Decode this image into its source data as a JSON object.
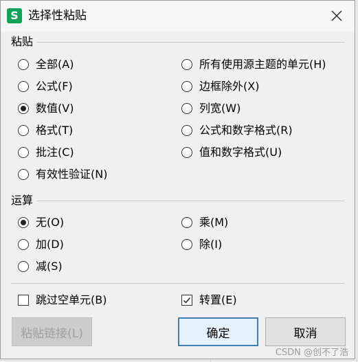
{
  "dialog": {
    "title": "选择性粘贴",
    "app_icon_letter": "S"
  },
  "paste": {
    "section_title": "粘贴",
    "options": [
      {
        "label": "全部(A)",
        "checked": false
      },
      {
        "label": "公式(F)",
        "checked": false
      },
      {
        "label": "数值(V)",
        "checked": true
      },
      {
        "label": "格式(T)",
        "checked": false
      },
      {
        "label": "批注(C)",
        "checked": false
      },
      {
        "label": "有效性验证(N)",
        "checked": false
      },
      {
        "label": "所有使用源主题的单元(H)",
        "checked": false
      },
      {
        "label": "边框除外(X)",
        "checked": false
      },
      {
        "label": "列宽(W)",
        "checked": false
      },
      {
        "label": "公式和数字格式(R)",
        "checked": false
      },
      {
        "label": "值和数字格式(U)",
        "checked": false
      }
    ]
  },
  "operation": {
    "section_title": "运算",
    "options": [
      {
        "label": "无(O)",
        "checked": true
      },
      {
        "label": "加(D)",
        "checked": false
      },
      {
        "label": "减(S)",
        "checked": false
      },
      {
        "label": "乘(M)",
        "checked": false
      },
      {
        "label": "除(I)",
        "checked": false
      }
    ]
  },
  "checkboxes": {
    "skip_blanks": {
      "label": "跳过空单元(B)",
      "checked": false
    },
    "transpose": {
      "label": "转置(E)",
      "checked": true
    }
  },
  "buttons": {
    "paste_link": "粘贴链接(L)",
    "ok": "确定",
    "cancel": "取消"
  },
  "watermark": "CSDN @创不了浩"
}
